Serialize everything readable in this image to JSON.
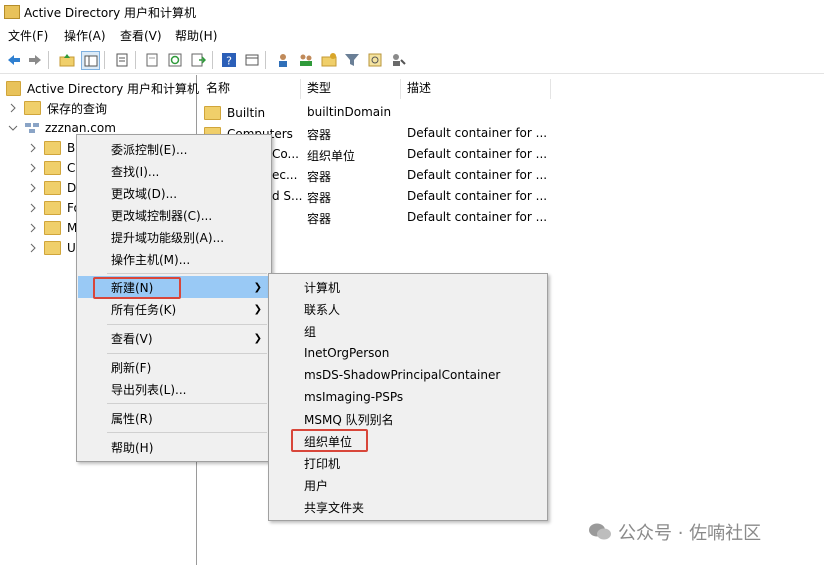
{
  "window": {
    "title": "Active Directory 用户和计算机"
  },
  "menubar": {
    "items": [
      "文件(F)",
      "操作(A)",
      "查看(V)",
      "帮助(H)"
    ]
  },
  "toolbar": {
    "icons": [
      "back-arrow-icon",
      "forward-arrow-icon",
      "up-folder-icon",
      "show-tree-icon",
      "properties-icon",
      "export-icon",
      "refresh-icon",
      "export-list-icon",
      "help-icon",
      "console-icon",
      "add-user-icon",
      "add-group-icon",
      "add-ou-icon",
      "filter-icon",
      "find-icon",
      "delegate-icon"
    ]
  },
  "tree": {
    "root": "Active Directory 用户和计算机",
    "items": [
      "保存的查询",
      "zzznan.com",
      "Bu",
      "Co",
      "Do",
      "Fo",
      "M",
      "Us"
    ]
  },
  "list": {
    "columns": [
      "名称",
      "类型",
      "描述"
    ],
    "rows": [
      {
        "name": "Builtin",
        "type": "builtinDomain",
        "desc": ""
      },
      {
        "name": "Computers",
        "type": "容器",
        "desc": "Default container for ..."
      },
      {
        "name": "Co...",
        "type": "组织单位",
        "desc": "Default container for ..."
      },
      {
        "name": "ec...",
        "type": "容器",
        "desc": "Default container for ..."
      },
      {
        "name": "d S...",
        "type": "容器",
        "desc": "Default container for ..."
      },
      {
        "name": "",
        "type": "容器",
        "desc": "Default container for ..."
      }
    ]
  },
  "context_menu": {
    "items": [
      "委派控制(E)...",
      "查找(I)...",
      "更改域(D)...",
      "更改域控制器(C)...",
      "提升域功能级别(A)...",
      "操作主机(M)...",
      "新建(N)",
      "所有任务(K)",
      "查看(V)",
      "刷新(F)",
      "导出列表(L)...",
      "属性(R)",
      "帮助(H)"
    ],
    "highlighted": "新建(N)"
  },
  "submenu": {
    "items": [
      "计算机",
      "联系人",
      "组",
      "InetOrgPerson",
      "msDS-ShadowPrincipalContainer",
      "msImaging-PSPs",
      "MSMQ 队列别名",
      "组织单位",
      "打印机",
      "用户",
      "共享文件夹"
    ]
  },
  "watermark": {
    "text": "公众号 · 佐喃社区"
  },
  "colors": {
    "highlight": "#99c9f5",
    "annotation_red": "#d8463a",
    "folder": "#f0cf6a"
  }
}
